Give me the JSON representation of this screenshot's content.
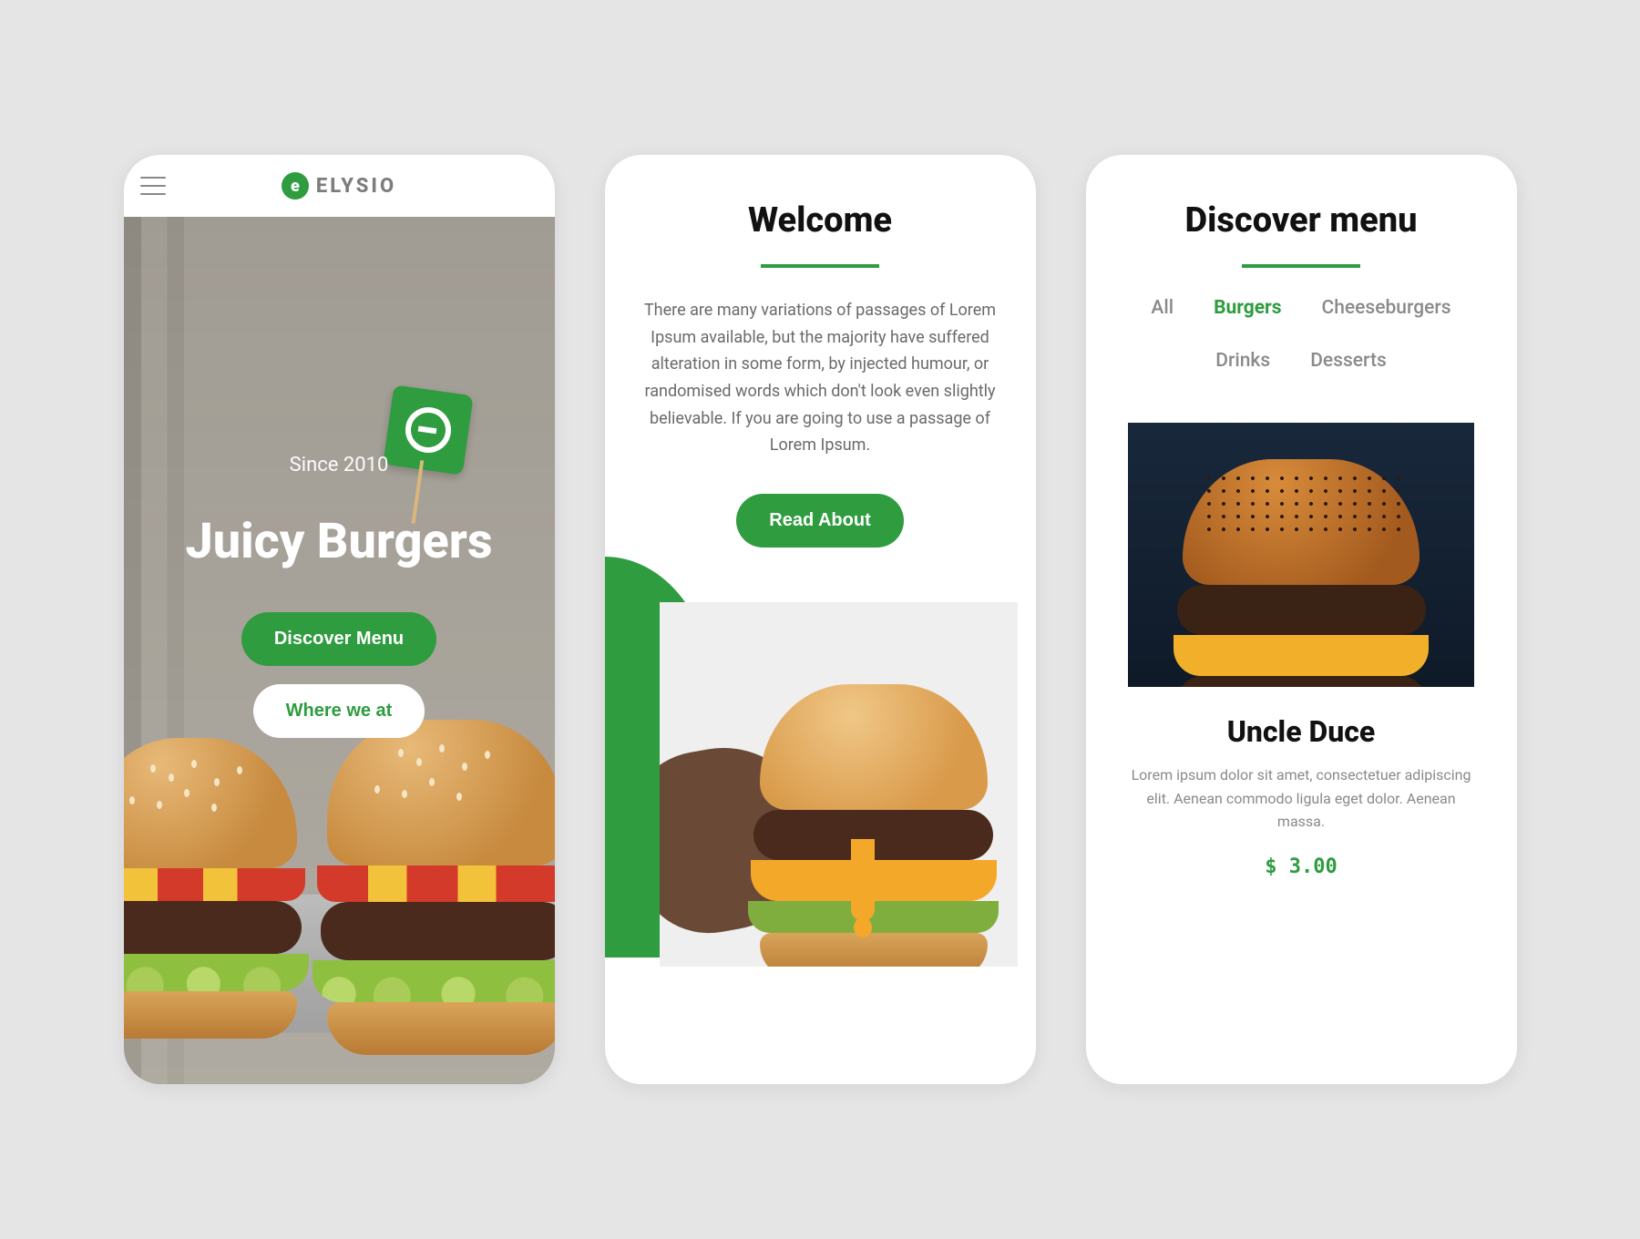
{
  "colors": {
    "brand": "#2e9c3f"
  },
  "header": {
    "logo_text": "ELYSIO"
  },
  "hero": {
    "since": "Since 2010",
    "title": "Juicy Burgers",
    "primary_cta": "Discover Menu",
    "secondary_cta": "Where we at"
  },
  "welcome": {
    "title": "Welcome",
    "text": "There are many variations of passages of Lorem Ipsum available, but the majority have suffered alteration in some form, by injected humour, or randomised words which don't look even slightly believable. If you are going to use a passage of Lorem Ipsum.",
    "cta": "Read About"
  },
  "menu": {
    "title": "Discover menu",
    "filters": [
      "All",
      "Burgers",
      "Cheeseburgers",
      "Drinks",
      "Desserts"
    ],
    "active_filter": "Burgers",
    "product": {
      "name": "Uncle Duce",
      "desc": "Lorem ipsum dolor sit amet, consectetuer adipiscing elit. Aenean commodo ligula eget dolor. Aenean massa.",
      "price": "$ 3.00"
    }
  }
}
